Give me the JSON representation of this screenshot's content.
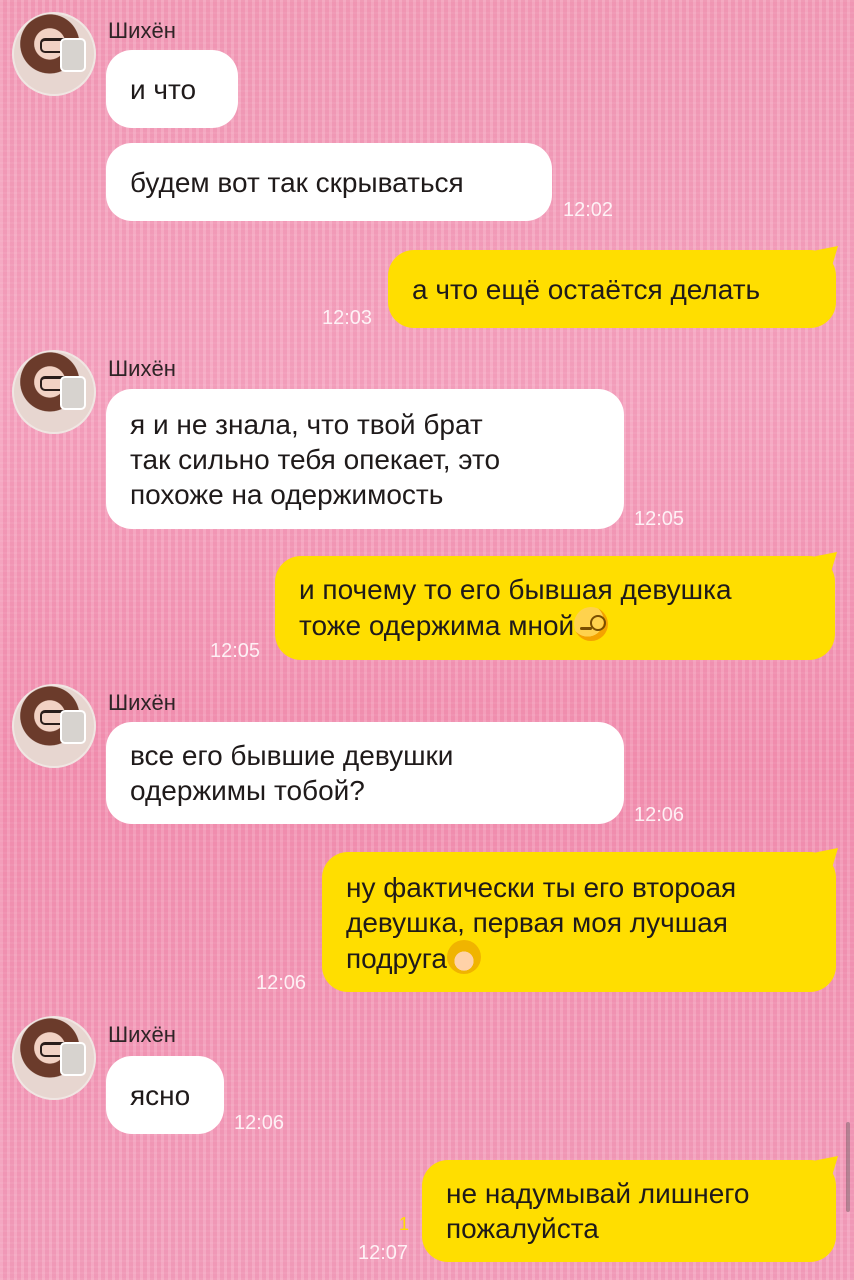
{
  "contact": {
    "name": "Шихён"
  },
  "messages": [
    {
      "dir": "in",
      "text": "и что"
    },
    {
      "dir": "in",
      "text": "будем вот так скрываться",
      "time": "12:02"
    },
    {
      "dir": "out",
      "text": "а что ещё остаётся делать",
      "time": "12:03"
    },
    {
      "dir": "in",
      "text_lines": [
        "я и не знала, что твой брат",
        "так сильно тебя опекает, это",
        "похоже на одержимость"
      ],
      "time": "12:05"
    },
    {
      "dir": "out",
      "text_lines": [
        "и почему то его бывшая девушка",
        "тоже одержима мной"
      ],
      "emoji": "face-with-monocle-icon",
      "time": "12:05"
    },
    {
      "dir": "in",
      "text_lines": [
        "все его бывшие девушки",
        "одержимы тобой?"
      ],
      "time": "12:06"
    },
    {
      "dir": "out",
      "text_lines": [
        "ну фактически ты его второая",
        "девушка, первая моя лучшая",
        "подруга"
      ],
      "emoji": "blond-woman-icon",
      "time": "12:06"
    },
    {
      "dir": "in",
      "text": "ясно",
      "time": "12:06"
    },
    {
      "dir": "out",
      "text_lines": [
        "не надумывай лишнего",
        "пожалуйста"
      ],
      "time": "12:07",
      "status": "1"
    }
  ],
  "colors": {
    "incoming": "#ffffff",
    "outgoing": "#ffde00",
    "background": "#f29bb7"
  }
}
